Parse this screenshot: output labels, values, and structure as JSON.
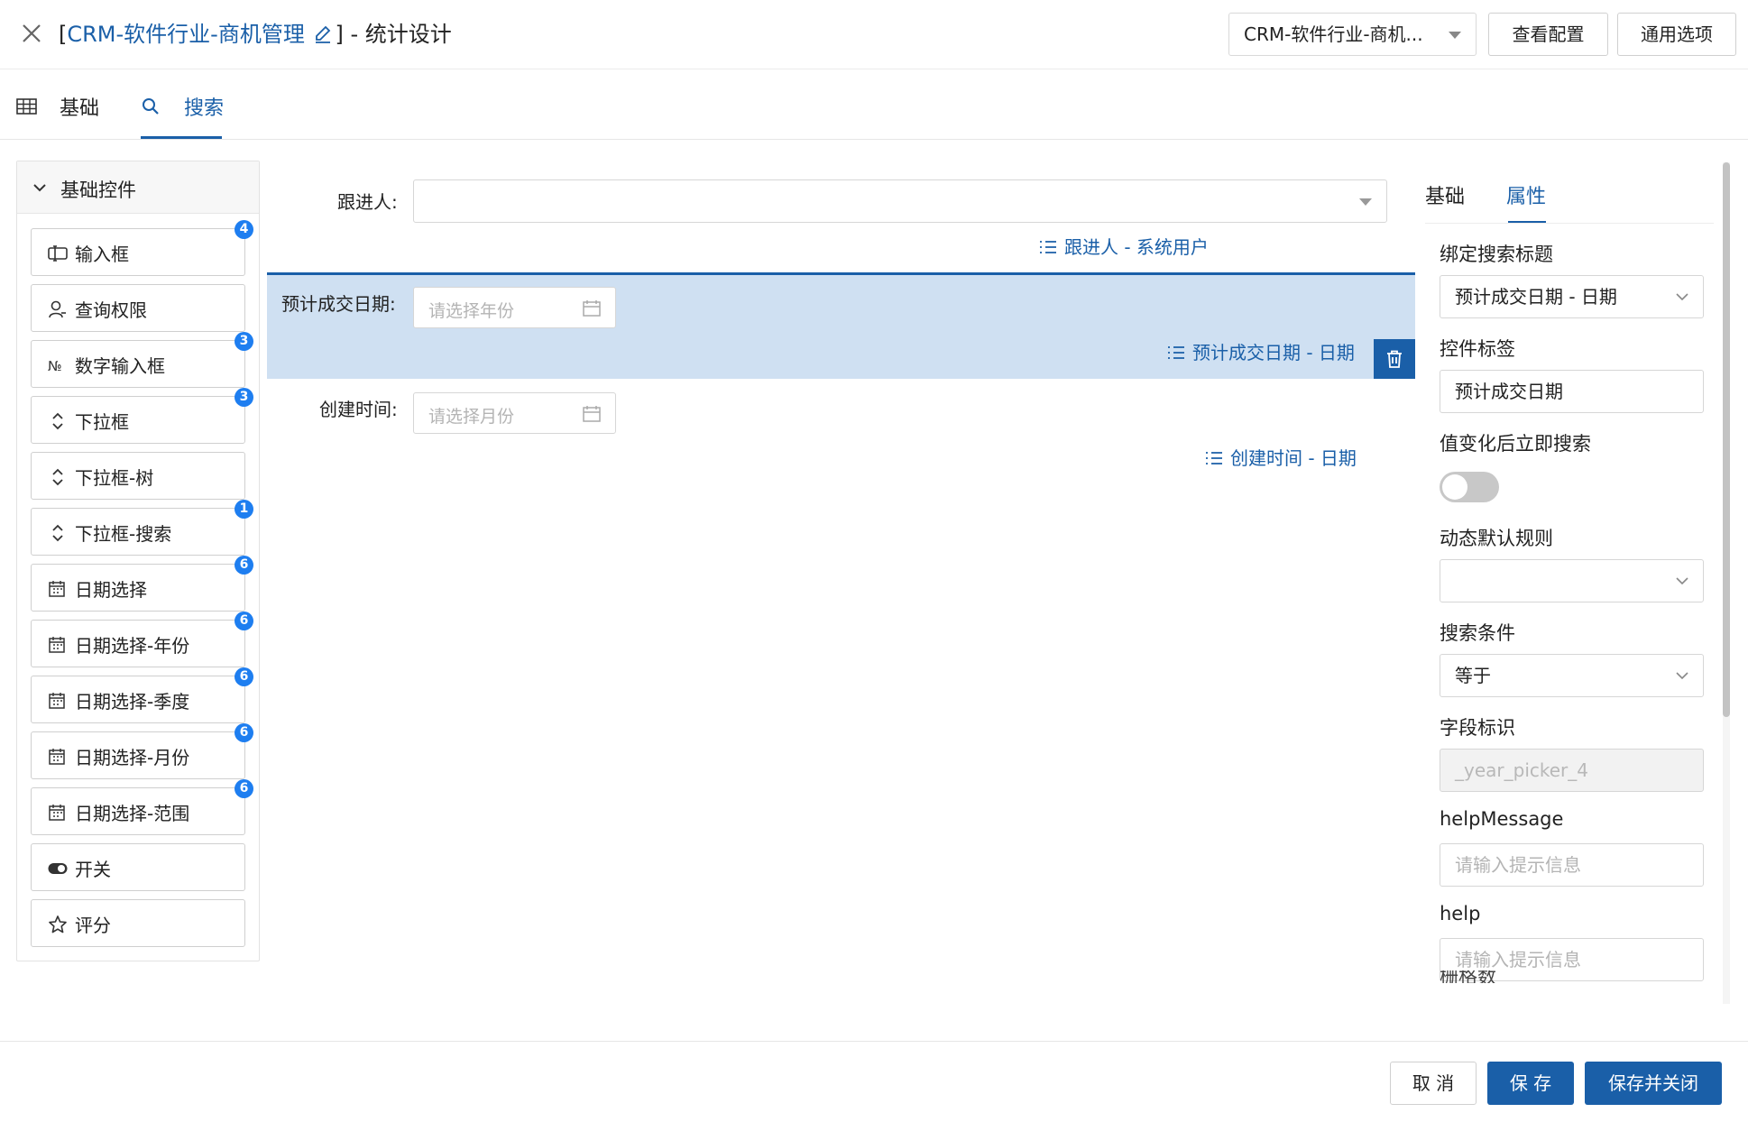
{
  "header": {
    "title_open": "[",
    "title_link": "CRM-软件行业-商机管理",
    "title_rest": "] - 统计设计",
    "selector_value": "CRM-软件行业-商机...",
    "view_config_label": "查看配置",
    "general_options_label": "通用选项"
  },
  "tabs": [
    {
      "label": "基础",
      "icon": "table-icon"
    },
    {
      "label": "搜索",
      "icon": "search-icon",
      "active": true
    }
  ],
  "left_panel": {
    "group_label": "基础控件",
    "controls": [
      {
        "label": "输入框",
        "icon": "input-icon",
        "badge": "4"
      },
      {
        "label": "查询权限",
        "icon": "user-icon",
        "badge": ""
      },
      {
        "label": "数字输入框",
        "icon": "number-icon",
        "badge": "3"
      },
      {
        "label": "下拉框",
        "icon": "updown-icon",
        "badge": "3"
      },
      {
        "label": "下拉框-树",
        "icon": "updown-icon",
        "badge": ""
      },
      {
        "label": "下拉框-搜索",
        "icon": "updown-icon",
        "badge": "1"
      },
      {
        "label": "日期选择",
        "icon": "calendar-icon",
        "badge": "6"
      },
      {
        "label": "日期选择-年份",
        "icon": "calendar-icon",
        "badge": "6"
      },
      {
        "label": "日期选择-季度",
        "icon": "calendar-icon",
        "badge": "6"
      },
      {
        "label": "日期选择-月份",
        "icon": "calendar-icon",
        "badge": "6"
      },
      {
        "label": "日期选择-范围",
        "icon": "calendar-icon",
        "badge": "6"
      },
      {
        "label": "开关",
        "icon": "switch-icon",
        "badge": ""
      },
      {
        "label": "评分",
        "icon": "star-icon",
        "badge": ""
      }
    ]
  },
  "form": {
    "follower_label": "跟进人:",
    "follower_binding": "跟进人 - 系统用户",
    "deal_date_label": "预计成交日期:",
    "deal_date_placeholder": "请选择年份",
    "deal_date_binding": "预计成交日期 - 日期",
    "created_label": "创建时间:",
    "created_placeholder": "请选择月份",
    "created_binding": "创建时间 - 日期"
  },
  "props": {
    "tab_basic": "基础",
    "tab_attr": "属性",
    "bind_title_label": "绑定搜索标题",
    "bind_title_value": "预计成交日期 - 日期",
    "control_label_label": "控件标签",
    "control_label_value": "预计成交日期",
    "instant_search_label": "值变化后立即搜索",
    "instant_search_on": false,
    "dynamic_default_label": "动态默认规则",
    "dynamic_default_value": "",
    "condition_label": "搜索条件",
    "condition_value": "等于",
    "field_id_label": "字段标识",
    "field_id_value": "_year_picker_4",
    "help_message_label": "helpMessage",
    "help_message_placeholder": "请输入提示信息",
    "help_label": "help",
    "help_placeholder": "请输入提示信息",
    "cut_label": "栅格数"
  },
  "footer": {
    "cancel": "取 消",
    "save": "保 存",
    "save_close": "保存并关闭"
  },
  "colors": {
    "accent": "#1a5fa8",
    "selected_row": "#cfe0f2",
    "badge": "#1e7ef0"
  }
}
